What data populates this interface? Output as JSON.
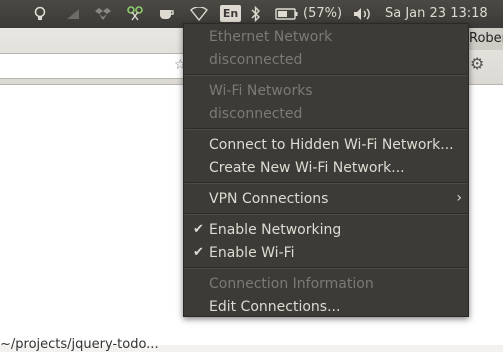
{
  "panel": {
    "language": "En",
    "battery_percent": "(57%)",
    "clock": "Sa Jan 23 13:18",
    "icons": [
      "lightbulb-icon",
      "network-signal-icon",
      "dropbox-icon",
      "scissors-icon",
      "cup-icon",
      "wifi-icon",
      "bluetooth-icon",
      "battery-icon",
      "volume-icon"
    ]
  },
  "window": {
    "user_tab": "Rober",
    "content_text": "~/projects/jquery-todo..."
  },
  "menu": {
    "ethernet_header": "Ethernet Network",
    "ethernet_status": "disconnected",
    "wifi_header": "Wi-Fi Networks",
    "wifi_status": "disconnected",
    "connect_hidden": "Connect to Hidden Wi-Fi Network...",
    "create_new": "Create New Wi-Fi Network...",
    "vpn": "VPN Connections",
    "enable_networking": "Enable Networking",
    "enable_wifi": "Enable Wi-Fi",
    "connection_info": "Connection Information",
    "edit_connections": "Edit Connections..."
  }
}
